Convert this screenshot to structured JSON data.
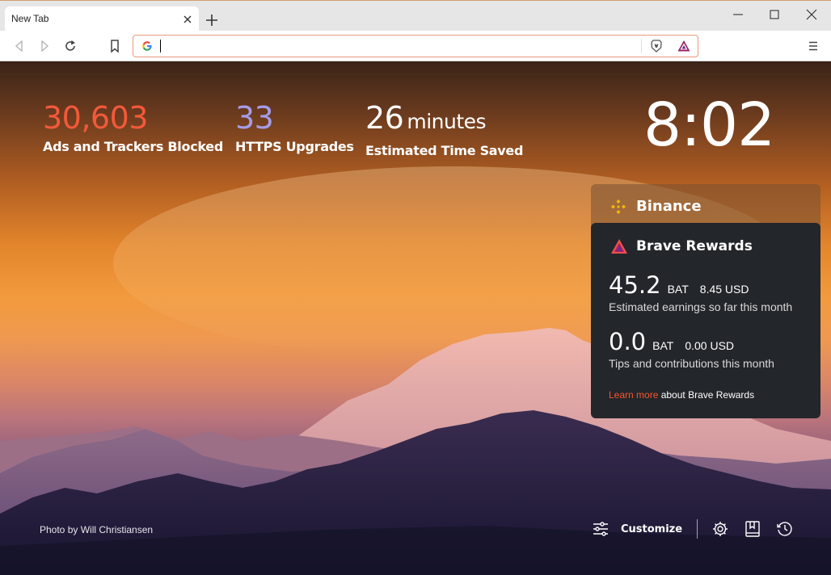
{
  "tab": {
    "title": "New Tab"
  },
  "omnibox": {
    "value": "",
    "placeholder": ""
  },
  "stats": {
    "trackers": {
      "value": "30,603",
      "label": "Ads and Trackers Blocked",
      "color": "#f3593a"
    },
    "https": {
      "value": "33",
      "label": "HTTPS Upgrades",
      "color": "#a59ce8"
    },
    "time": {
      "value": "26",
      "unit": "minutes",
      "label": "Estimated Time Saved",
      "color": "#ffffff"
    }
  },
  "clock": "8:02",
  "binance": {
    "name": "Binance",
    "color": "#f0b90b"
  },
  "rewards": {
    "title": "Brave Rewards",
    "earnings": {
      "amount": "45.2",
      "currency": "BAT",
      "usd": "8.45 USD",
      "description": "Estimated earnings so far this month"
    },
    "tips": {
      "amount": "0.0",
      "currency": "BAT",
      "usd": "0.00 USD",
      "description": "Tips and contributions this month"
    },
    "footer": {
      "link": "Learn more",
      "text": " about Brave Rewards"
    }
  },
  "photo_credit": {
    "prefix": "Photo by ",
    "author": "Will Christiansen"
  },
  "customize_label": "Customize",
  "icons": [
    "back-icon",
    "forward-icon",
    "reload-icon",
    "bookmark-icon",
    "google-icon",
    "brave-shields-icon",
    "brave-rewards-icon",
    "menu-icon",
    "customize-icon",
    "settings-icon",
    "bookmarks-icon",
    "history-icon"
  ]
}
